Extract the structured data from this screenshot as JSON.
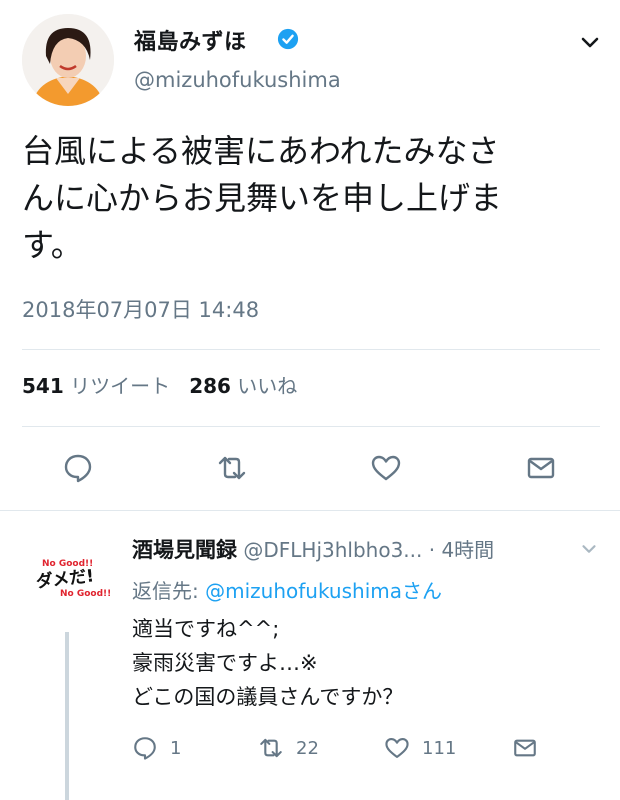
{
  "tweet": {
    "author_name": "福島みずほ",
    "author_handle": "@mizuhofukushima",
    "text_lines": [
      "台風による被害にあわれたみなさ",
      "んに心からお見舞いを申し上げま",
      "す。"
    ],
    "timestamp": "2018年07月07日 14:48",
    "retweet_count": "541",
    "retweet_label": "リツイート",
    "like_count": "286",
    "like_label": "いいね"
  },
  "reply": {
    "author_name": "酒場見聞録",
    "author_handle": "@DFLHj3hlbho3...",
    "time": "· 4時間",
    "replying_prefix": "返信先:",
    "replying_to": "@mizuhofukushima",
    "replying_suffix": "さん",
    "text_lines": [
      "適当ですね^^;",
      "豪雨災害ですよ…※",
      "どこの国の議員さんですか？"
    ],
    "reply_count": "1",
    "retweet_count": "22",
    "like_count": "111",
    "avatar_text": {
      "top": "No Good!!",
      "main": "ダメだ!",
      "bottom": "No Good!!"
    }
  },
  "colors": {
    "link": "#1da1f2",
    "secondary_text": "#657786",
    "divider": "#e1e8ed",
    "avatar_accent": "#e0242f"
  },
  "icons": [
    "verified-badge-icon",
    "chevron-down-icon",
    "reply-icon",
    "retweet-icon",
    "like-icon",
    "share-icon"
  ]
}
